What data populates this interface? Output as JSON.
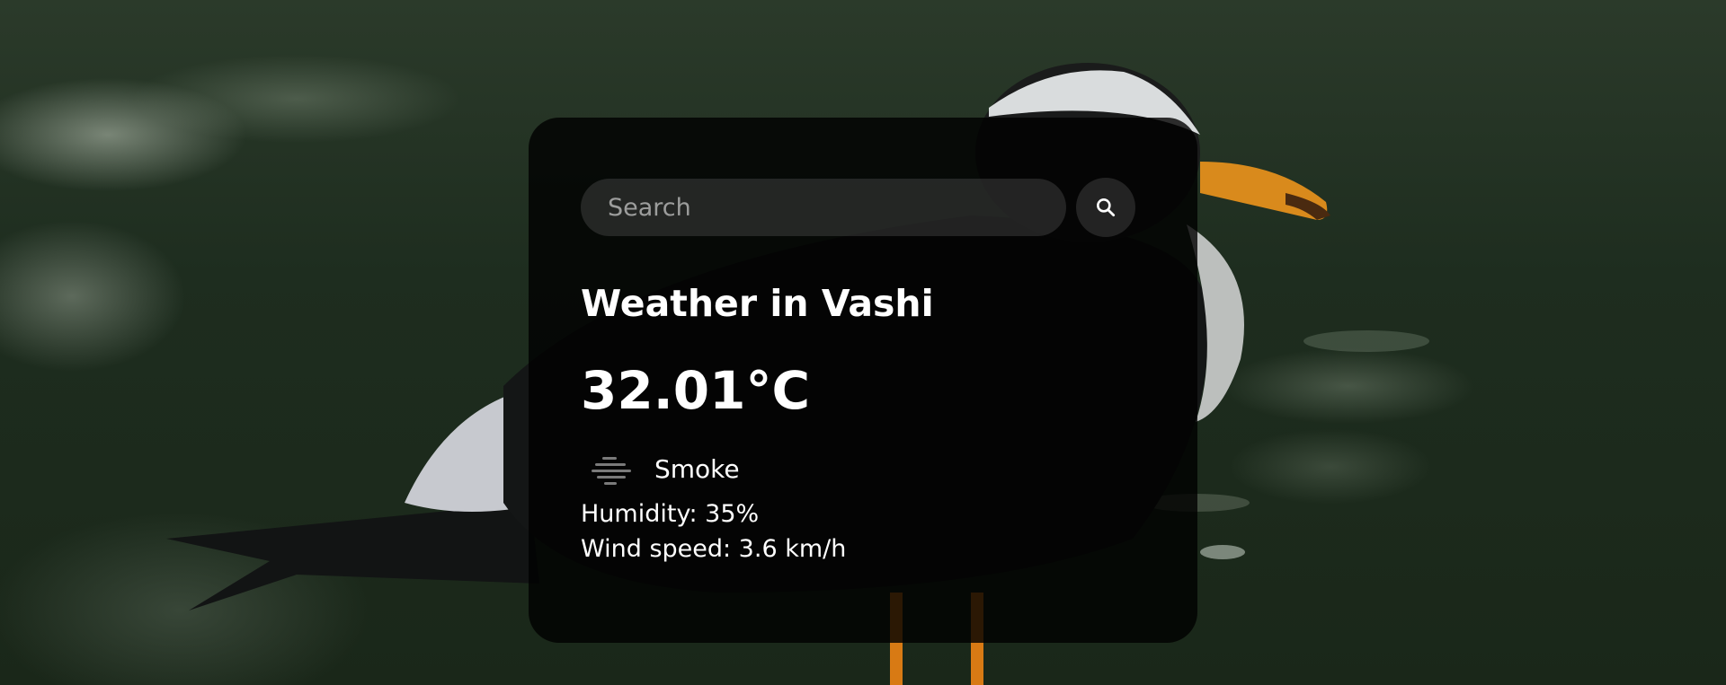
{
  "search": {
    "placeholder": "Search",
    "value": ""
  },
  "weather": {
    "city_heading": "Weather in Vashi",
    "temperature": "32.01°C",
    "description": "Smoke",
    "humidity": "Humidity: 35%",
    "wind": "Wind speed: 3.6 km/h"
  },
  "icons": {
    "search": "search-icon",
    "condition": "smoke-haze-icon"
  },
  "colors": {
    "card_background": "#000000cc",
    "text": "#ffffff",
    "input_background": "#ffffff1f"
  }
}
